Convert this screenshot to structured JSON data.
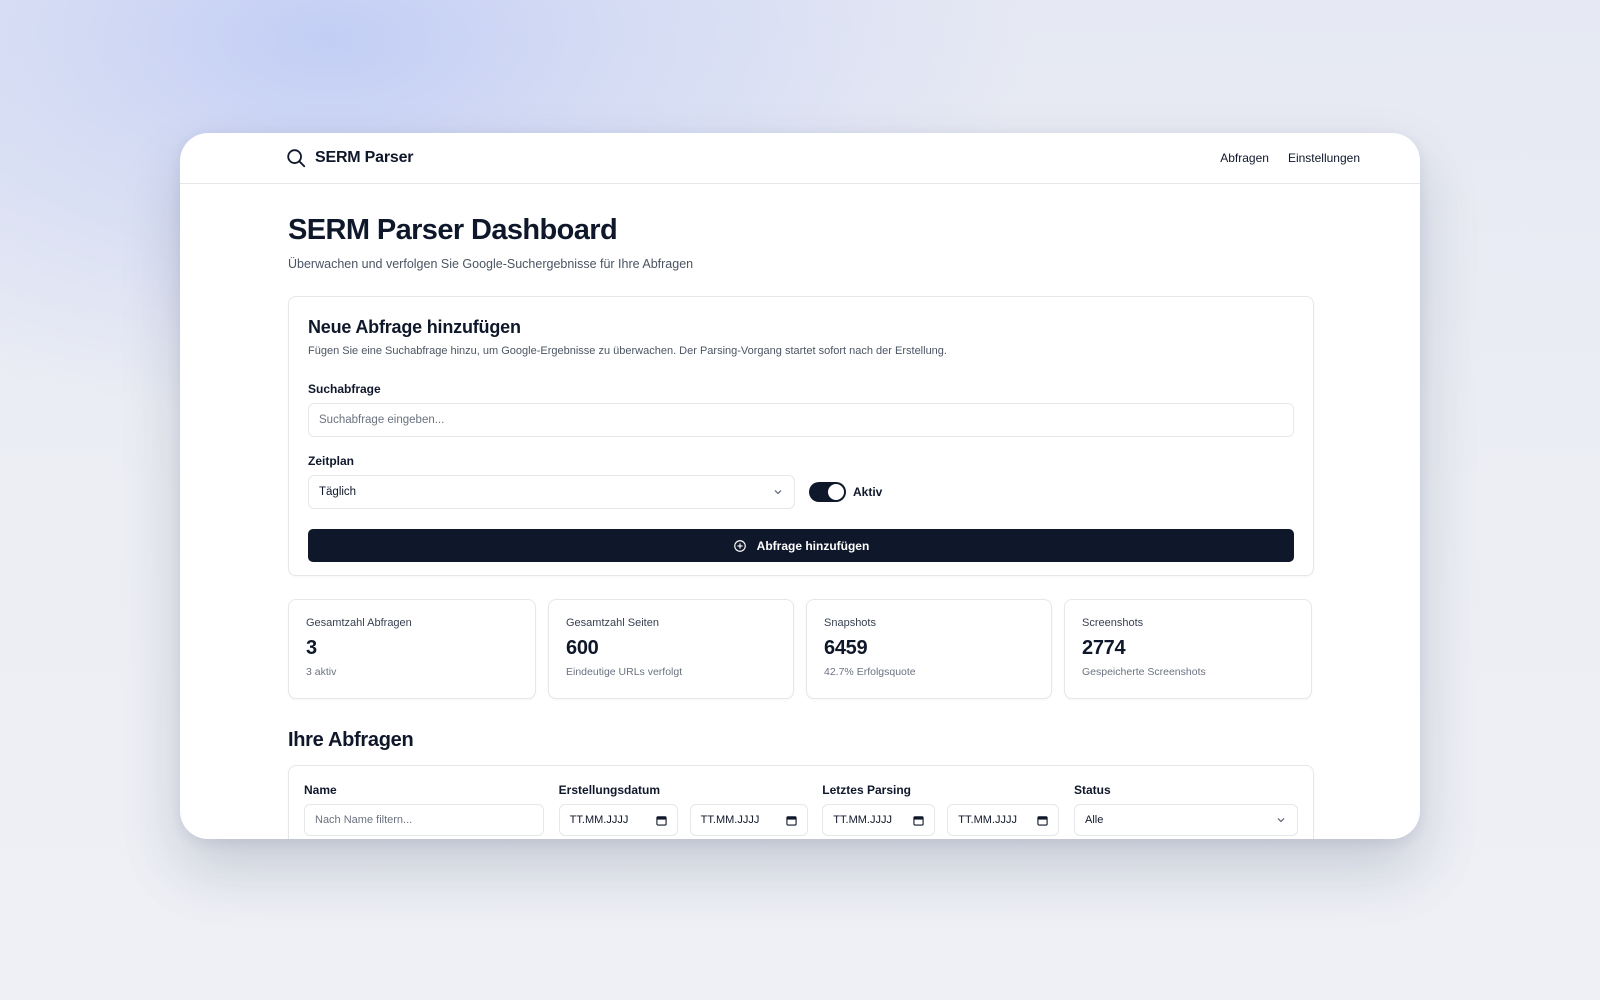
{
  "app": {
    "name": "SERM Parser"
  },
  "nav": {
    "queries": "Abfragen",
    "settings": "Einstellungen"
  },
  "header": {
    "title": "SERM Parser Dashboard",
    "subtitle": "Überwachen und verfolgen Sie Google-Suchergebnisse für Ihre Abfragen"
  },
  "form": {
    "title": "Neue Abfrage hinzufügen",
    "description": "Fügen Sie eine Suchabfrage hinzu, um Google-Ergebnisse zu überwachen. Der Parsing-Vorgang startet sofort nach der Erstellung.",
    "query_label": "Suchabfrage",
    "query_placeholder": "Suchabfrage eingeben...",
    "schedule_label": "Zeitplan",
    "schedule_value": "Täglich",
    "active_label": "Aktiv",
    "active": true,
    "submit_label": "Abfrage hinzufügen"
  },
  "stats": [
    {
      "label": "Gesamtzahl Abfragen",
      "value": "3",
      "sub": "3 aktiv"
    },
    {
      "label": "Gesamtzahl Seiten",
      "value": "600",
      "sub": "Eindeutige URLs verfolgt"
    },
    {
      "label": "Snapshots",
      "value": "6459",
      "sub": "42.7% Erfolgsquote"
    },
    {
      "label": "Screenshots",
      "value": "2774",
      "sub": "Gespeicherte Screenshots"
    }
  ],
  "queries_section": {
    "title": "Ihre Abfragen",
    "filters": {
      "name_label": "Name",
      "name_placeholder": "Nach Name filtern...",
      "created_label": "Erstellungsdatum",
      "last_parsing_label": "Letztes Parsing",
      "date_placeholder": "TT.MM.JJJJ",
      "status_label": "Status",
      "status_value": "Alle"
    }
  },
  "colors": {
    "primary": "#0f172a",
    "border": "#e5e7eb",
    "muted": "#6b7280"
  }
}
